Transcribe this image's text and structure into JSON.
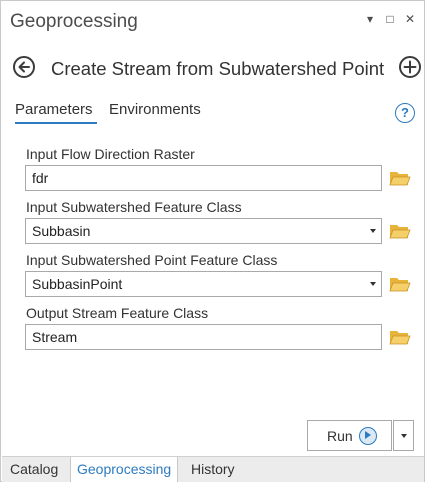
{
  "pane": {
    "title": "Geoprocessing",
    "controls": [
      "▾",
      "□",
      "✕"
    ]
  },
  "header": {
    "tool_title": "Create Stream from Subwatershed Point"
  },
  "tabs": {
    "parameters": "Parameters",
    "environments": "Environments",
    "help": "?"
  },
  "params": [
    {
      "label": "Input Flow Direction Raster",
      "value": "fdr",
      "kind": "text"
    },
    {
      "label": "Input Subwatershed Feature Class",
      "value": "Subbasin",
      "kind": "dropdown"
    },
    {
      "label": "Input Subwatershed Point Feature Class",
      "value": "SubbasinPoint",
      "kind": "dropdown"
    },
    {
      "label": "Output Stream Feature Class",
      "value": "Stream",
      "kind": "text"
    }
  ],
  "run": {
    "label": "Run"
  },
  "bottom_tabs": [
    "Catalog",
    "Geoprocessing",
    "History"
  ],
  "colors": {
    "accent": "#2c7bbf",
    "folder": "#e8b339",
    "border": "#a9a9a9"
  }
}
